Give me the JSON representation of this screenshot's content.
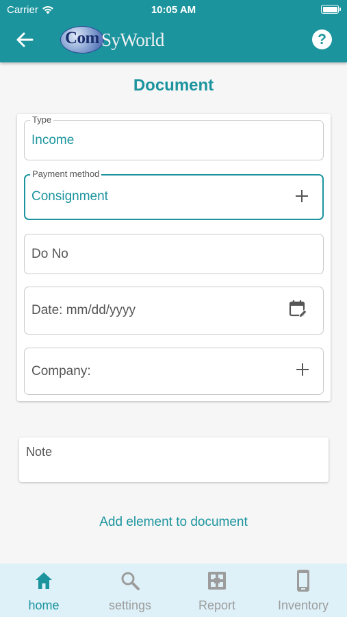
{
  "status_bar": {
    "carrier": "Carrier",
    "time": "10:05 AM"
  },
  "app_bar": {
    "logo_com": "Com",
    "logo_rest": "SyWorld",
    "help_label": "?"
  },
  "page_title": "Document",
  "form": {
    "type": {
      "label": "Type",
      "value": "Income"
    },
    "payment_method": {
      "label": "Payment method",
      "value": "Consignment"
    },
    "do_no": {
      "placeholder": "Do No"
    },
    "date": {
      "placeholder": "Date: mm/dd/yyyy"
    },
    "company": {
      "placeholder": "Company:"
    }
  },
  "note": {
    "placeholder": "Note"
  },
  "add_element_link": "Add element to document",
  "bottom_nav": [
    {
      "label": "home",
      "icon": "home-icon",
      "active": true
    },
    {
      "label": "settings",
      "icon": "search-icon",
      "active": false
    },
    {
      "label": "Report",
      "icon": "report-icon",
      "active": false
    },
    {
      "label": "Inventory",
      "icon": "phone-icon",
      "active": false
    }
  ],
  "colors": {
    "accent": "#1b949e",
    "nav_bg": "#def1f8",
    "inactive": "#9c9c9c"
  }
}
